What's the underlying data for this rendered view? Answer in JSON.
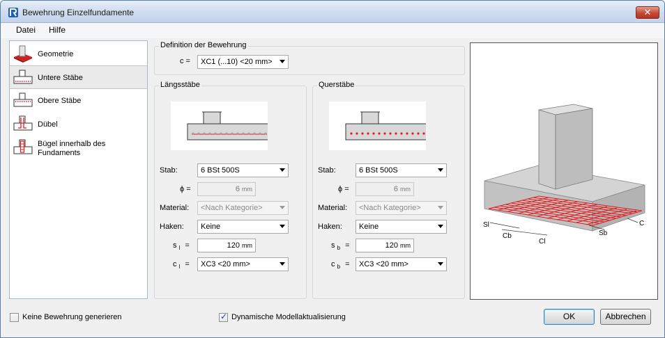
{
  "window": {
    "title": "Bewehrung Einzelfundamente",
    "close_label": "✕"
  },
  "menu": {
    "items": [
      "Datei",
      "Hilfe"
    ]
  },
  "sidebar": {
    "items": [
      {
        "label": "Geometrie",
        "icon": "geometry-icon"
      },
      {
        "label": "Untere Stäbe",
        "icon": "bottom-bars-icon",
        "selected": true
      },
      {
        "label": "Obere Stäbe",
        "icon": "top-bars-icon"
      },
      {
        "label": "Dübel",
        "icon": "dowel-icon"
      },
      {
        "label": "Bügel innerhalb des Fundaments",
        "icon": "stirrups-icon"
      }
    ]
  },
  "definition": {
    "title": "Definition der Bewehrung",
    "c_label": "c =",
    "c_value": "XC1 (...10) <20 mm>"
  },
  "laengs": {
    "title": "Längsstäbe",
    "stab_label": "Stab:",
    "stab_value": "6 BSt 500S",
    "phi_label": "ϕ =",
    "phi_value": "6",
    "phi_unit": "mm",
    "material_label": "Material:",
    "material_value": "<Nach Kategorie>",
    "haken_label": "Haken:",
    "haken_value": "Keine",
    "s_label": "s",
    "s_sub": "l",
    "s_eq": "=",
    "s_value": "120",
    "s_unit": "mm",
    "c_label": "c",
    "c_sub": "l",
    "c_eq": "=",
    "c_value": "XC3 <20 mm>"
  },
  "quer": {
    "title": "Querstäbe",
    "stab_label": "Stab:",
    "stab_value": "6 BSt 500S",
    "phi_label": "ϕ =",
    "phi_value": "6",
    "phi_unit": "mm",
    "material_label": "Material:",
    "material_value": "<Nach Kategorie>",
    "haken_label": "Haken:",
    "haken_value": "Keine",
    "s_label": "s",
    "s_sub": "b",
    "s_eq": "=",
    "s_value": "120",
    "s_unit": "mm",
    "c_label": "c",
    "c_sub": "b",
    "c_eq": "=",
    "c_value": "XC3 <20 mm>"
  },
  "preview": {
    "labels": {
      "sl": "Sl",
      "cb": "Cb",
      "cl": "Cl",
      "sb": "Sb",
      "c": "C"
    }
  },
  "footer": {
    "no_reinforcement_label": "Keine Bewehrung generieren",
    "no_reinforcement_checked": false,
    "dynamic_update_label": "Dynamische Modellaktualisierung",
    "dynamic_update_checked": true,
    "ok_label": "OK",
    "cancel_label": "Abbrechen"
  },
  "colors": {
    "rebar": "#e8191b",
    "accent": "#3c7fb1"
  }
}
